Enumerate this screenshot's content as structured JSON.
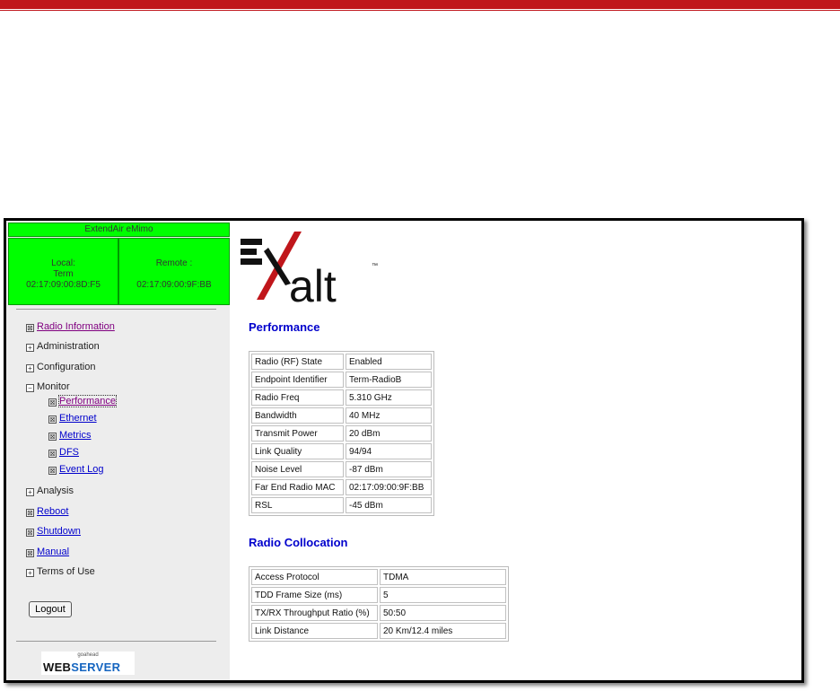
{
  "sidebar": {
    "app_title": "ExtendAir eMimo",
    "local": {
      "label": "Local:",
      "name": "Term",
      "mac": "02:17:09:00:8D:F5"
    },
    "remote": {
      "label": "Remote :",
      "mac": "02:17:09:00:9F:BB"
    },
    "nav": {
      "radio_information": "Radio Information",
      "administration": "Administration",
      "configuration": "Configuration",
      "monitor": "Monitor",
      "performance": "Performance",
      "ethernet": "Ethernet",
      "metrics": "Metrics",
      "dfs": "DFS",
      "event_log": "Event Log",
      "analysis": "Analysis",
      "reboot": "Reboot",
      "shutdown": "Shutdown",
      "manual": "Manual",
      "terms_of_use": "Terms of Use"
    },
    "logout_label": "Logout",
    "webserver": {
      "top": "goahead",
      "web": "WEB",
      "server": "SERVER"
    }
  },
  "brand": {
    "name": "alt",
    "tm": "™"
  },
  "performance": {
    "title": "Performance",
    "rows": [
      {
        "label": "Radio (RF) State",
        "value": "Enabled"
      },
      {
        "label": "Endpoint Identifier",
        "value": "Term-RadioB"
      },
      {
        "label": "Radio Freq",
        "value": "5.310 GHz"
      },
      {
        "label": "Bandwidth",
        "value": "40 MHz"
      },
      {
        "label": "Transmit Power",
        "value": "20 dBm"
      },
      {
        "label": "Link Quality",
        "value": "94/94"
      },
      {
        "label": "Noise Level",
        "value": "-87 dBm"
      },
      {
        "label": "Far End Radio MAC",
        "value": "02:17:09:00:9F:BB"
      },
      {
        "label": "RSL",
        "value": "-45 dBm"
      }
    ]
  },
  "collocation": {
    "title": "Radio Collocation",
    "rows": [
      {
        "label": "Access Protocol",
        "value": "TDMA"
      },
      {
        "label": "TDD Frame Size (ms)",
        "value": "5"
      },
      {
        "label": "TX/RX Throughput Ratio (%)",
        "value": "50:50"
      },
      {
        "label": "Link Distance",
        "value": "20 Km/12.4 miles"
      }
    ]
  },
  "colors": {
    "header_green": "#00ff00",
    "link_blue": "#0000cc",
    "brand_red": "#c0161b"
  }
}
